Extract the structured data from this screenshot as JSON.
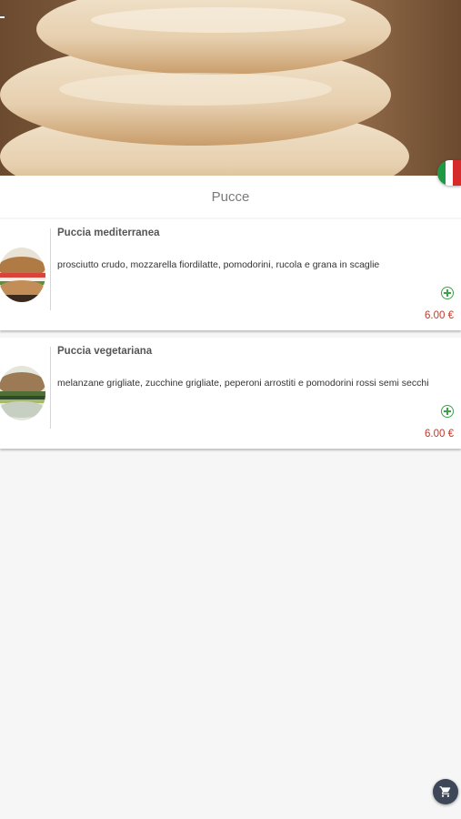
{
  "hero": {
    "image": "stacked-puccia-bread-photo"
  },
  "language": {
    "flag": "italy-flag",
    "colors": [
      "#1e9a45",
      "#ffffff",
      "#d62b2b"
    ]
  },
  "category": {
    "title": "Pucce"
  },
  "products": [
    {
      "name": "Puccia mediterranea",
      "description": "prosciutto crudo, mozzarella fiordilatte, pomodorini, rucola e grana in scaglie",
      "price": "6.00 €",
      "thumb": "puccia-mediterranea-photo"
    },
    {
      "name": "Puccia vegetariana",
      "description": "melanzane grigliate, zucchine grigliate, peperoni arrostiti e pomodorini rossi semi secchi",
      "price": "6.00 €",
      "thumb": "puccia-vegetariana-photo"
    }
  ],
  "colors": {
    "price": "#c0392b",
    "add": "#3aa34a",
    "fab": "#3d4757"
  },
  "cart": {
    "icon": "cart-icon"
  }
}
